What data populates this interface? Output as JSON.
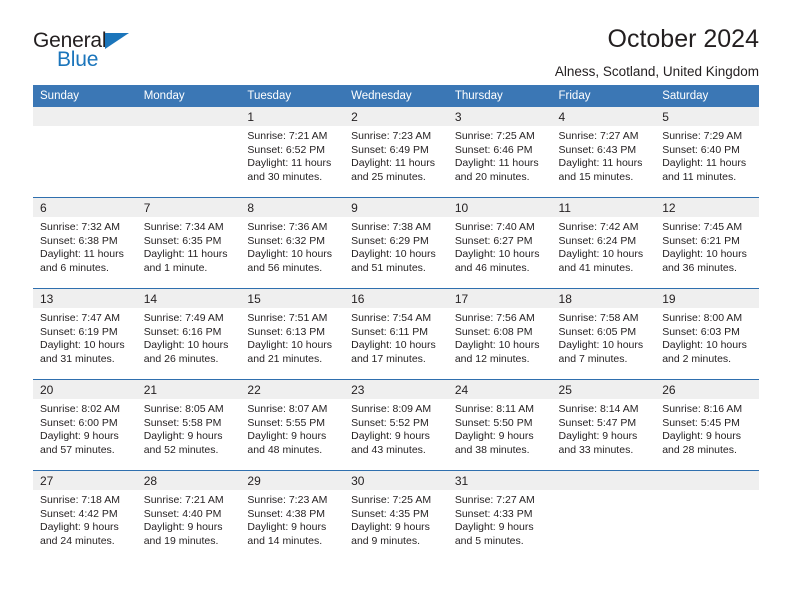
{
  "brand": {
    "name_part1": "General",
    "name_part2": "Blue",
    "triangle_color": "#1b75bb"
  },
  "header": {
    "title": "October 2024",
    "location": "Alness, Scotland, United Kingdom"
  },
  "theme": {
    "header_blue": "#3b77b5",
    "rule_blue": "#2f6fae",
    "daynum_band": "#efefef",
    "text": "#231f20"
  },
  "weekday_headers": [
    "Sunday",
    "Monday",
    "Tuesday",
    "Wednesday",
    "Thursday",
    "Friday",
    "Saturday"
  ],
  "weeks": [
    [
      {
        "day": "",
        "sunrise": "",
        "sunset": "",
        "daylight_line1": "",
        "daylight_line2": ""
      },
      {
        "day": "",
        "sunrise": "",
        "sunset": "",
        "daylight_line1": "",
        "daylight_line2": ""
      },
      {
        "day": "1",
        "sunrise": "Sunrise: 7:21 AM",
        "sunset": "Sunset: 6:52 PM",
        "daylight_line1": "Daylight: 11 hours",
        "daylight_line2": "and 30 minutes."
      },
      {
        "day": "2",
        "sunrise": "Sunrise: 7:23 AM",
        "sunset": "Sunset: 6:49 PM",
        "daylight_line1": "Daylight: 11 hours",
        "daylight_line2": "and 25 minutes."
      },
      {
        "day": "3",
        "sunrise": "Sunrise: 7:25 AM",
        "sunset": "Sunset: 6:46 PM",
        "daylight_line1": "Daylight: 11 hours",
        "daylight_line2": "and 20 minutes."
      },
      {
        "day": "4",
        "sunrise": "Sunrise: 7:27 AM",
        "sunset": "Sunset: 6:43 PM",
        "daylight_line1": "Daylight: 11 hours",
        "daylight_line2": "and 15 minutes."
      },
      {
        "day": "5",
        "sunrise": "Sunrise: 7:29 AM",
        "sunset": "Sunset: 6:40 PM",
        "daylight_line1": "Daylight: 11 hours",
        "daylight_line2": "and 11 minutes."
      }
    ],
    [
      {
        "day": "6",
        "sunrise": "Sunrise: 7:32 AM",
        "sunset": "Sunset: 6:38 PM",
        "daylight_line1": "Daylight: 11 hours",
        "daylight_line2": "and 6 minutes."
      },
      {
        "day": "7",
        "sunrise": "Sunrise: 7:34 AM",
        "sunset": "Sunset: 6:35 PM",
        "daylight_line1": "Daylight: 11 hours",
        "daylight_line2": "and 1 minute."
      },
      {
        "day": "8",
        "sunrise": "Sunrise: 7:36 AM",
        "sunset": "Sunset: 6:32 PM",
        "daylight_line1": "Daylight: 10 hours",
        "daylight_line2": "and 56 minutes."
      },
      {
        "day": "9",
        "sunrise": "Sunrise: 7:38 AM",
        "sunset": "Sunset: 6:29 PM",
        "daylight_line1": "Daylight: 10 hours",
        "daylight_line2": "and 51 minutes."
      },
      {
        "day": "10",
        "sunrise": "Sunrise: 7:40 AM",
        "sunset": "Sunset: 6:27 PM",
        "daylight_line1": "Daylight: 10 hours",
        "daylight_line2": "and 46 minutes."
      },
      {
        "day": "11",
        "sunrise": "Sunrise: 7:42 AM",
        "sunset": "Sunset: 6:24 PM",
        "daylight_line1": "Daylight: 10 hours",
        "daylight_line2": "and 41 minutes."
      },
      {
        "day": "12",
        "sunrise": "Sunrise: 7:45 AM",
        "sunset": "Sunset: 6:21 PM",
        "daylight_line1": "Daylight: 10 hours",
        "daylight_line2": "and 36 minutes."
      }
    ],
    [
      {
        "day": "13",
        "sunrise": "Sunrise: 7:47 AM",
        "sunset": "Sunset: 6:19 PM",
        "daylight_line1": "Daylight: 10 hours",
        "daylight_line2": "and 31 minutes."
      },
      {
        "day": "14",
        "sunrise": "Sunrise: 7:49 AM",
        "sunset": "Sunset: 6:16 PM",
        "daylight_line1": "Daylight: 10 hours",
        "daylight_line2": "and 26 minutes."
      },
      {
        "day": "15",
        "sunrise": "Sunrise: 7:51 AM",
        "sunset": "Sunset: 6:13 PM",
        "daylight_line1": "Daylight: 10 hours",
        "daylight_line2": "and 21 minutes."
      },
      {
        "day": "16",
        "sunrise": "Sunrise: 7:54 AM",
        "sunset": "Sunset: 6:11 PM",
        "daylight_line1": "Daylight: 10 hours",
        "daylight_line2": "and 17 minutes."
      },
      {
        "day": "17",
        "sunrise": "Sunrise: 7:56 AM",
        "sunset": "Sunset: 6:08 PM",
        "daylight_line1": "Daylight: 10 hours",
        "daylight_line2": "and 12 minutes."
      },
      {
        "day": "18",
        "sunrise": "Sunrise: 7:58 AM",
        "sunset": "Sunset: 6:05 PM",
        "daylight_line1": "Daylight: 10 hours",
        "daylight_line2": "and 7 minutes."
      },
      {
        "day": "19",
        "sunrise": "Sunrise: 8:00 AM",
        "sunset": "Sunset: 6:03 PM",
        "daylight_line1": "Daylight: 10 hours",
        "daylight_line2": "and 2 minutes."
      }
    ],
    [
      {
        "day": "20",
        "sunrise": "Sunrise: 8:02 AM",
        "sunset": "Sunset: 6:00 PM",
        "daylight_line1": "Daylight: 9 hours",
        "daylight_line2": "and 57 minutes."
      },
      {
        "day": "21",
        "sunrise": "Sunrise: 8:05 AM",
        "sunset": "Sunset: 5:58 PM",
        "daylight_line1": "Daylight: 9 hours",
        "daylight_line2": "and 52 minutes."
      },
      {
        "day": "22",
        "sunrise": "Sunrise: 8:07 AM",
        "sunset": "Sunset: 5:55 PM",
        "daylight_line1": "Daylight: 9 hours",
        "daylight_line2": "and 48 minutes."
      },
      {
        "day": "23",
        "sunrise": "Sunrise: 8:09 AM",
        "sunset": "Sunset: 5:52 PM",
        "daylight_line1": "Daylight: 9 hours",
        "daylight_line2": "and 43 minutes."
      },
      {
        "day": "24",
        "sunrise": "Sunrise: 8:11 AM",
        "sunset": "Sunset: 5:50 PM",
        "daylight_line1": "Daylight: 9 hours",
        "daylight_line2": "and 38 minutes."
      },
      {
        "day": "25",
        "sunrise": "Sunrise: 8:14 AM",
        "sunset": "Sunset: 5:47 PM",
        "daylight_line1": "Daylight: 9 hours",
        "daylight_line2": "and 33 minutes."
      },
      {
        "day": "26",
        "sunrise": "Sunrise: 8:16 AM",
        "sunset": "Sunset: 5:45 PM",
        "daylight_line1": "Daylight: 9 hours",
        "daylight_line2": "and 28 minutes."
      }
    ],
    [
      {
        "day": "27",
        "sunrise": "Sunrise: 7:18 AM",
        "sunset": "Sunset: 4:42 PM",
        "daylight_line1": "Daylight: 9 hours",
        "daylight_line2": "and 24 minutes."
      },
      {
        "day": "28",
        "sunrise": "Sunrise: 7:21 AM",
        "sunset": "Sunset: 4:40 PM",
        "daylight_line1": "Daylight: 9 hours",
        "daylight_line2": "and 19 minutes."
      },
      {
        "day": "29",
        "sunrise": "Sunrise: 7:23 AM",
        "sunset": "Sunset: 4:38 PM",
        "daylight_line1": "Daylight: 9 hours",
        "daylight_line2": "and 14 minutes."
      },
      {
        "day": "30",
        "sunrise": "Sunrise: 7:25 AM",
        "sunset": "Sunset: 4:35 PM",
        "daylight_line1": "Daylight: 9 hours",
        "daylight_line2": "and 9 minutes."
      },
      {
        "day": "31",
        "sunrise": "Sunrise: 7:27 AM",
        "sunset": "Sunset: 4:33 PM",
        "daylight_line1": "Daylight: 9 hours",
        "daylight_line2": "and 5 minutes."
      },
      {
        "day": "",
        "sunrise": "",
        "sunset": "",
        "daylight_line1": "",
        "daylight_line2": ""
      },
      {
        "day": "",
        "sunrise": "",
        "sunset": "",
        "daylight_line1": "",
        "daylight_line2": ""
      }
    ]
  ]
}
